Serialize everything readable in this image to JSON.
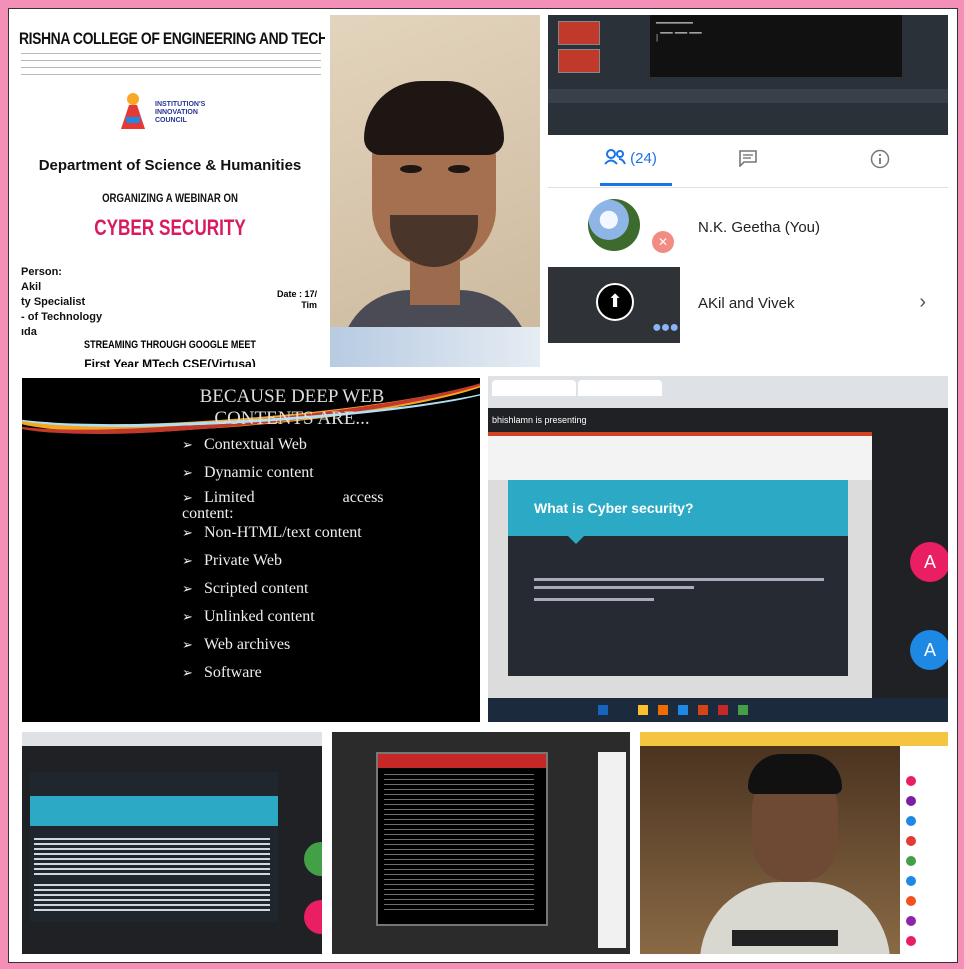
{
  "poster": {
    "college": "RISHNA COLLEGE OF  ENGINEERING AND TECHNO",
    "iic": [
      "INSTITUTION'S",
      "INNOVATION",
      "COUNCIL"
    ],
    "department": "Department of Science & Humanities",
    "organizing": "ORGANIZING A WEBINAR ON",
    "topic": "CYBER SECURITY",
    "resource_lines": [
      "Person:",
      "Akil",
      "ty Specialist",
      "- of Technology",
      "ıda"
    ],
    "date_lines": [
      "Date : 17/",
      "Tim"
    ],
    "streaming": "STREAMING THROUGH GOOGLE MEET",
    "audience": "First Year MTech CSE(Virtusa)"
  },
  "meet_panel": {
    "people_count": "(24)",
    "participants": [
      {
        "name": "N.K. Geetha (You)"
      },
      {
        "name": "AKil and Vivek"
      }
    ],
    "colors": {
      "accent": "#1a73e8",
      "muted_mic": "#f28b82"
    }
  },
  "deep_web_slide": {
    "title_line1": "BECAUSE DEEP WEB",
    "title_line2": "CONTENTS ARE...",
    "items": [
      "Contextual Web",
      "Dynamic content",
      "Limited",
      "Non-HTML/text content",
      "Private Web",
      "Scripted content",
      "Unlinked content",
      "Web archives",
      "Software"
    ],
    "limited_right": "access",
    "limited_cont": "content:"
  },
  "presentation": {
    "presenting_label": "bhishlamn is presenting",
    "slide_title": "What is Cyber security?"
  },
  "icons": [
    "people-icon",
    "chat-icon",
    "info-icon",
    "mic-off-icon",
    "present-icon",
    "more-icon",
    "chevron-right-icon"
  ]
}
